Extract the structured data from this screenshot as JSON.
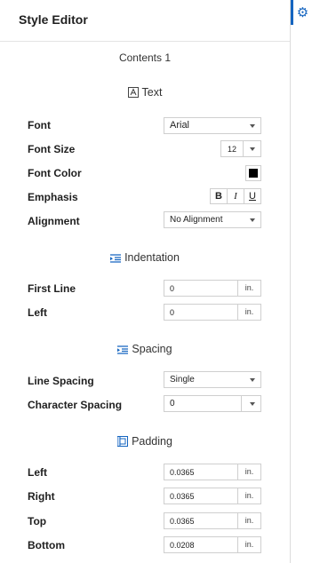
{
  "header": {
    "title": "Style Editor"
  },
  "subtitle": "Contents 1",
  "sections": {
    "text": "Text",
    "indentation": "Indentation",
    "spacing": "Spacing",
    "padding": "Padding"
  },
  "text": {
    "font_label": "Font",
    "font_value": "Arial",
    "font_size_label": "Font Size",
    "font_size_value": "12",
    "font_color_label": "Font Color",
    "font_color_value": "#000000",
    "emphasis_label": "Emphasis",
    "bold": "B",
    "italic": "I",
    "underline": "U",
    "alignment_label": "Alignment",
    "alignment_value": "No Alignment"
  },
  "indentation": {
    "first_line_label": "First Line",
    "first_line_value": "0",
    "left_label": "Left",
    "left_value": "0",
    "unit": "in."
  },
  "spacing": {
    "line_label": "Line Spacing",
    "line_value": "Single",
    "char_label": "Character Spacing",
    "char_value": "0"
  },
  "padding": {
    "left_label": "Left",
    "left_value": "0.0365",
    "right_label": "Right",
    "right_value": "0.0365",
    "top_label": "Top",
    "top_value": "0.0365",
    "bottom_label": "Bottom",
    "bottom_value": "0.0208",
    "unit": "in."
  },
  "colors": {
    "accent": "#1565c0"
  }
}
